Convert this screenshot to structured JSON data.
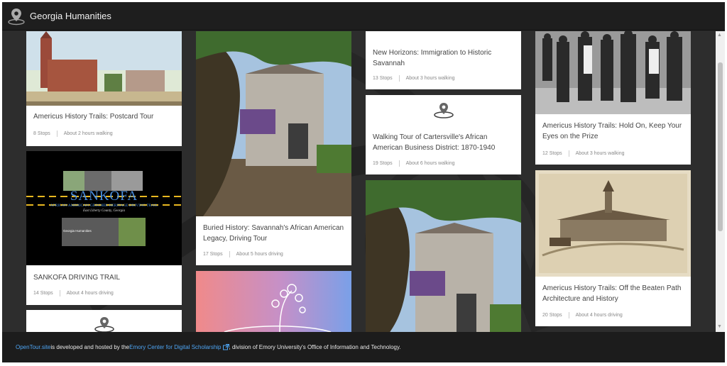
{
  "app": {
    "title": "Georgia Humanities"
  },
  "tours": [
    {
      "title": "Americus History Trails: Postcard Tour",
      "stops": "8 Stops",
      "duration": "About 2 hours walking"
    },
    {
      "image_text": "SANKOFA",
      "image_subtitle": "AFRICAN AMERICAN-GEECHEE HERITAGE DRIVING TRAIL",
      "image_county": "East Liberty County, Georgia",
      "image_org": "Georgia Humanities",
      "title": "SANKOFA DRIVING TRAIL",
      "stops": "14 Stops",
      "duration": "About 4 hours driving"
    },
    {
      "title": "Buried History: Savannah's African American Legacy, Driving Tour",
      "stops": "17 Stops",
      "duration": "About 5 hours driving"
    },
    {
      "title": "New Horizons: Immigration to Historic Savannah",
      "stops": "13 Stops",
      "duration": "About 3 hours walking"
    },
    {
      "title": "Walking Tour of Cartersville's African American Business District: 1870-1940",
      "stops": "19 Stops",
      "duration": "About 6 hours walking"
    },
    {
      "title": "Americus History Trails: Hold On, Keep Your Eyes on the Prize",
      "stops": "12 Stops",
      "duration": "About 3 hours walking"
    },
    {
      "title": "Americus History Trails: Off the Beaten Path Architecture and History",
      "stops": "20 Stops",
      "duration": "About 4 hours driving"
    }
  ],
  "footer": {
    "link1": "OpenTour.site",
    "text1": " is developed and hosted by the ",
    "link2": "Emory Center for Digital Scholarship",
    "text2": ", division of Emory University's Office of Information and Technology."
  },
  "colors": {
    "link": "#4ea5f4",
    "topbar": "#1e1e1e",
    "background": "#2d2d2d"
  }
}
